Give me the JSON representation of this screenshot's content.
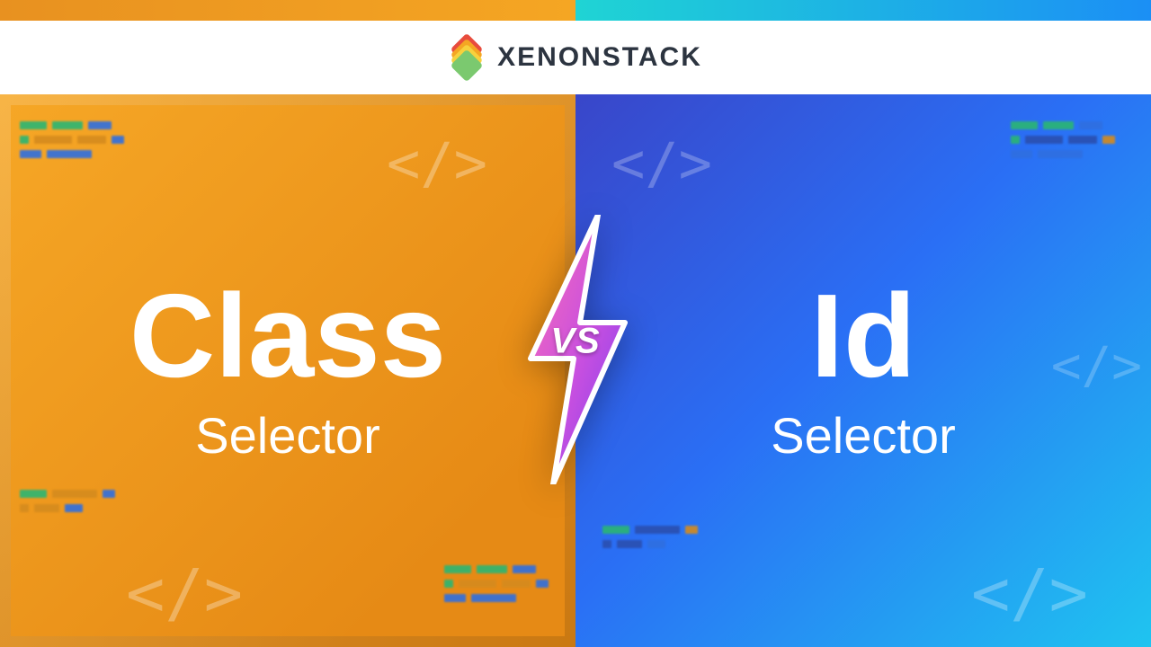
{
  "brand": "XENONSTACK",
  "left": {
    "title": "Class",
    "subtitle": "Selector"
  },
  "right": {
    "title": "Id",
    "subtitle": "Selector"
  },
  "vs": "VS",
  "code_glyph": "</>"
}
